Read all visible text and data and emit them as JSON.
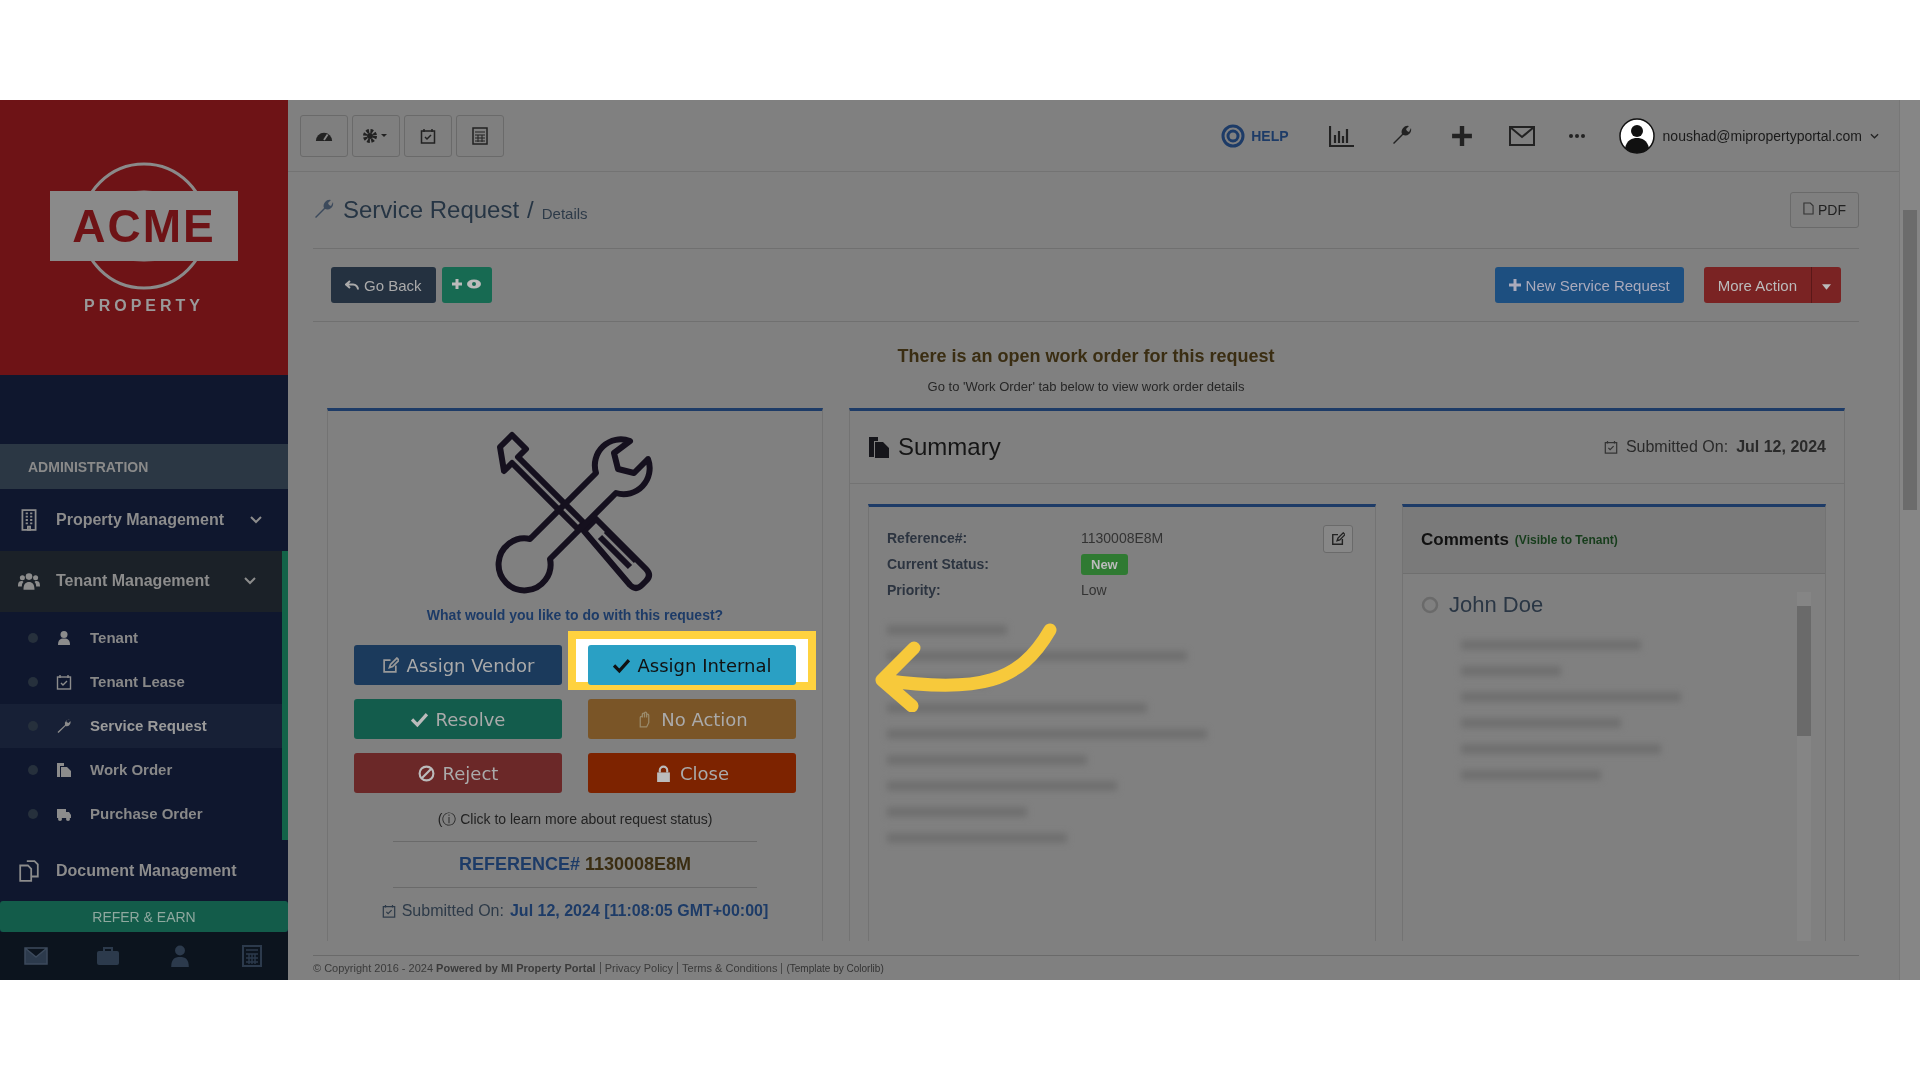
{
  "logo": {
    "name": "ACME",
    "tagline": "PROPERTY"
  },
  "sidebar": {
    "section": "ADMINISTRATION",
    "items": [
      {
        "label": "Property Management",
        "expanded": false
      },
      {
        "label": "Tenant Management",
        "expanded": true,
        "children": [
          {
            "label": "Tenant",
            "selected": false
          },
          {
            "label": "Tenant Lease",
            "selected": false
          },
          {
            "label": "Service Request",
            "selected": true
          },
          {
            "label": "Work Order",
            "selected": false
          },
          {
            "label": "Purchase Order",
            "selected": false
          }
        ]
      },
      {
        "label": "Document Management",
        "expanded": false
      }
    ],
    "refer": "REFER & EARN"
  },
  "topbar": {
    "help": "HELP",
    "user": "noushad@mipropertyportal.com"
  },
  "header": {
    "title": "Service Request",
    "separator": "/",
    "crumb": "Details",
    "pdf": "PDF"
  },
  "toolbar": {
    "back": "Go Back",
    "new": "New Service Request",
    "more": "More Action"
  },
  "notice": {
    "title": "There is an open work order for this request",
    "sub": "Go to 'Work Order' tab below to view work order details"
  },
  "actions": {
    "question": "What would you like to do with this request?",
    "buttons": [
      {
        "label": "Assign Vendor",
        "color": "#1b3a5c",
        "highlighted": false
      },
      {
        "label": "Assign Internal",
        "color": "#2aa0c4",
        "highlighted": true
      },
      {
        "label": "Resolve",
        "color": "#135c4c",
        "highlighted": false
      },
      {
        "label": "No Action",
        "color": "#7a5527",
        "highlighted": false
      },
      {
        "label": "Reject",
        "color": "#6b2828",
        "highlighted": false
      },
      {
        "label": "Close",
        "color": "#7d2300",
        "highlighted": false
      }
    ],
    "status_link": "(ⓘ Click to learn more about request status)",
    "ref_label": "REFERENCE#",
    "ref_value": "1130008E8M",
    "submitted_label": "Submitted On:",
    "submitted_value": "Jul 12, 2024 [11:08:05 GMT+00:00]"
  },
  "summary": {
    "title": "Summary",
    "submitted_label": "Submitted On:",
    "submitted_value": "Jul 12, 2024",
    "fields": [
      {
        "label": "Reference#:",
        "value": "1130008E8M",
        "kind": "text"
      },
      {
        "label": "Current Status:",
        "value": "New",
        "kind": "badge"
      },
      {
        "label": "Priority:",
        "value": "Low",
        "kind": "text"
      }
    ],
    "comments_title": "Comments",
    "comments_note": "(Visible to Tenant)",
    "comment_author": "John Doe"
  },
  "footer": {
    "copyright": "© Copyright 2016 - 2024 **Powered by MI Property Portal**",
    "links": [
      "Privacy Policy",
      "Terms & Conditions"
    ],
    "template": "(Template by Colorlib)"
  }
}
